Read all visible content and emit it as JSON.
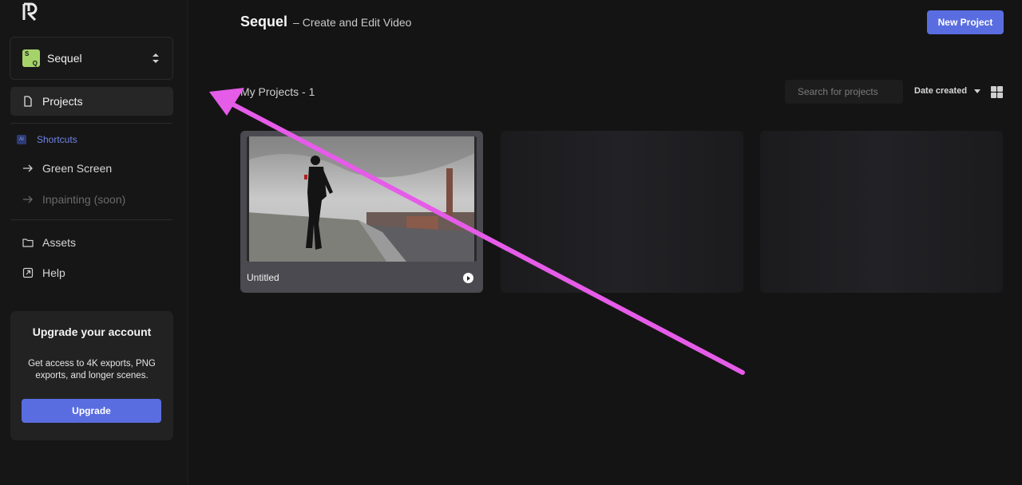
{
  "sidebar": {
    "workspace": {
      "avatar_top": "S",
      "avatar_bottom": "Q",
      "name": "Sequel"
    },
    "nav": {
      "projects": "Projects",
      "shortcuts_badge": "AI",
      "shortcuts": "Shortcuts",
      "green_screen": "Green Screen",
      "inpainting": "Inpainting (soon)",
      "assets": "Assets",
      "help": "Help"
    },
    "upgrade": {
      "title": "Upgrade your account",
      "description": "Get access to 4K exports, PNG exports, and longer scenes.",
      "button": "Upgrade"
    }
  },
  "header": {
    "title": "Sequel",
    "subtitle": "– Create and Edit Video",
    "new_project": "New Project"
  },
  "projects": {
    "heading": "My Projects - 1",
    "search_placeholder": "Search for projects",
    "sort_label": "Date created",
    "items": [
      {
        "name": "Untitled"
      }
    ]
  },
  "colors": {
    "accent": "#5a6de0",
    "annotation_arrow": "#e55ce8"
  }
}
